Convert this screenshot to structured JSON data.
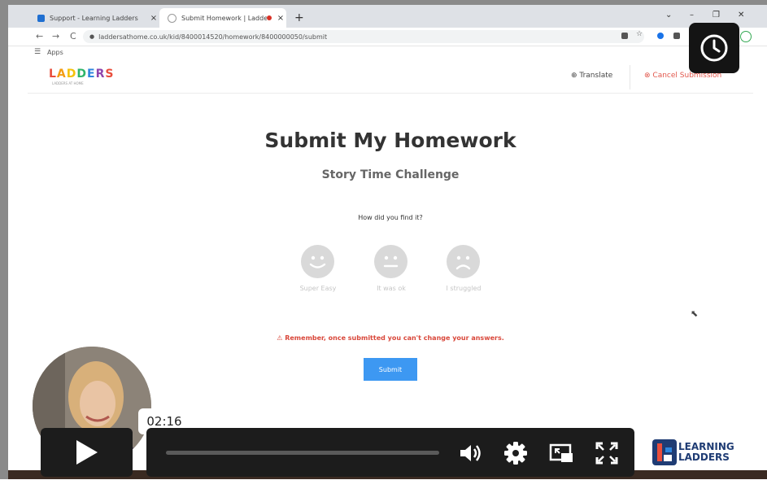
{
  "browser": {
    "tabs": [
      {
        "title": "Support - Learning Ladders",
        "close": "×"
      },
      {
        "title": "Submit Homework | Ladders",
        "close": "×"
      }
    ],
    "new_tab": "+",
    "window_controls": [
      "⌄",
      "–",
      "❐",
      "✕"
    ],
    "nav": {
      "back": "←",
      "forward": "→",
      "reload": "C"
    },
    "url": "laddersathome.co.uk/kid/8400014520/homework/8400000050/submit",
    "bookmarks": {
      "apps_label": "Apps"
    }
  },
  "site": {
    "logo_letters": [
      "L",
      "A",
      "D",
      "D",
      "E",
      "R",
      "S"
    ],
    "logo_colors": [
      "#e94e3c",
      "#f39c12",
      "#f4c20d",
      "#2fb56a",
      "#2e86de",
      "#8e44ad",
      "#e94e3c"
    ],
    "logo_tagline": "LADDERS AT HOME",
    "translate_label": "Translate",
    "cancel_label": "Cancel Submission"
  },
  "main": {
    "title": "Submit My Homework",
    "subtitle": "Story Time Challenge",
    "question": "How did you find it?",
    "ratings": [
      {
        "label": "Super Easy",
        "icon": "smile-icon"
      },
      {
        "label": "It was ok",
        "icon": "neutral-face-icon"
      },
      {
        "label": "I struggled",
        "icon": "sad-face-icon"
      }
    ],
    "warning": "Remember, once submitted you can't change your answers.",
    "submit_label": "Submit"
  },
  "video_player": {
    "timestamp": "02:16",
    "progress_fraction": 0.0
  },
  "brand_logo": {
    "line1": "LEARNING",
    "line2": "LADDERS"
  }
}
